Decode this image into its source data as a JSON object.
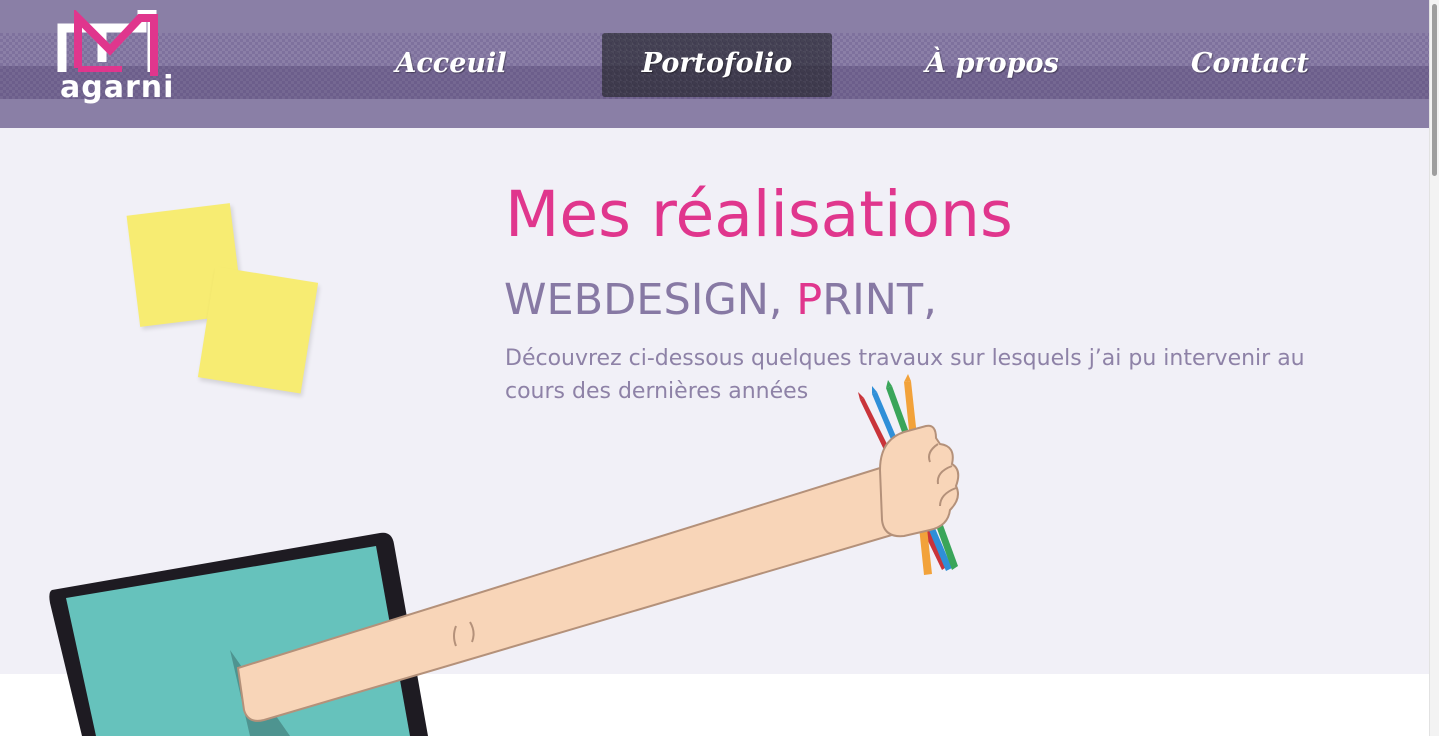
{
  "brand": {
    "logo_text": "agarni",
    "colors": {
      "header": "#8a7fa6",
      "accent": "#e0368d",
      "muted": "#8779a4",
      "hero_bg": "#f1f0f7"
    }
  },
  "nav": {
    "items": [
      {
        "label": "Acceuil"
      },
      {
        "label": "Portofolio",
        "active": true
      },
      {
        "label": "À propos"
      },
      {
        "label": "Contact"
      }
    ]
  },
  "hero": {
    "title": "Mes réalisations",
    "subtitle_part1": "WEBDESIGN, ",
    "subtitle_accent": "P",
    "subtitle_part2": "RINT,",
    "description": "Découvrez ci-dessous quelques travaux sur lesquels j’ai pu intervenir au cours des dernières années"
  },
  "illustration": {
    "icons": [
      "sticky-notes",
      "laptop",
      "arm",
      "colored-pencils"
    ]
  }
}
